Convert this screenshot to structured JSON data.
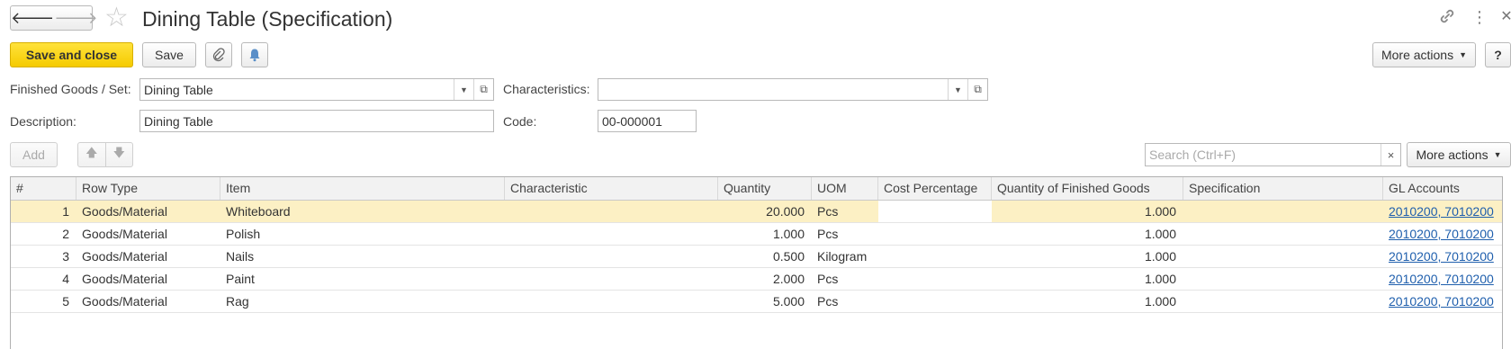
{
  "window": {
    "title": "Dining Table (Specification)",
    "back_icon": "arrow-left-icon",
    "forward_icon": "arrow-right-icon",
    "favorite_icon": "star-icon",
    "link_icon": "link-icon",
    "menu_icon": "vertical-dots-icon",
    "close_icon": "close-icon"
  },
  "toolbar": {
    "save_and_close_label": "Save and close",
    "save_label": "Save",
    "attach_icon": "paperclip-icon",
    "notify_icon": "bell-icon",
    "more_actions_label": "More actions",
    "help_label": "?"
  },
  "form": {
    "finished_goods_label": "Finished Goods / Set:",
    "finished_goods_value": "Dining Table",
    "characteristics_label": "Characteristics:",
    "characteristics_value": "",
    "description_label": "Description:",
    "description_value": "Dining Table",
    "code_label": "Code:",
    "code_value": "00-000001"
  },
  "table_toolbar": {
    "add_label": "Add",
    "move_up_icon": "arrow-up-icon",
    "move_down_icon": "arrow-down-icon",
    "search_placeholder": "Search (Ctrl+F)",
    "clear_search_label": "×",
    "more_actions_label": "More actions"
  },
  "table": {
    "columns": [
      "#",
      "Row Type",
      "Item",
      "Characteristic",
      "Quantity",
      "UOM",
      "Cost Percentage",
      "Quantity of Finished Goods",
      "Specification",
      "GL Accounts"
    ],
    "rows": [
      {
        "n": "1",
        "row_type": "Goods/Material",
        "item": "Whiteboard",
        "characteristic": "",
        "quantity": "20.000",
        "uom": "Pcs",
        "cost_percentage": "",
        "qty_finished": "1.000",
        "specification": "",
        "gl_accounts": "2010200, 7010200"
      },
      {
        "n": "2",
        "row_type": "Goods/Material",
        "item": "Polish",
        "characteristic": "",
        "quantity": "1.000",
        "uom": "Pcs",
        "cost_percentage": "",
        "qty_finished": "1.000",
        "specification": "",
        "gl_accounts": "2010200, 7010200"
      },
      {
        "n": "3",
        "row_type": "Goods/Material",
        "item": "Nails",
        "characteristic": "",
        "quantity": "0.500",
        "uom": "Kilogram",
        "cost_percentage": "",
        "qty_finished": "1.000",
        "specification": "",
        "gl_accounts": "2010200, 7010200"
      },
      {
        "n": "4",
        "row_type": "Goods/Material",
        "item": "Paint",
        "characteristic": "",
        "quantity": "2.000",
        "uom": "Pcs",
        "cost_percentage": "",
        "qty_finished": "1.000",
        "specification": "",
        "gl_accounts": "2010200, 7010200"
      },
      {
        "n": "5",
        "row_type": "Goods/Material",
        "item": "Rag",
        "characteristic": "",
        "quantity": "5.000",
        "uom": "Pcs",
        "cost_percentage": "",
        "qty_finished": "1.000",
        "specification": "",
        "gl_accounts": "2010200, 7010200"
      }
    ]
  }
}
